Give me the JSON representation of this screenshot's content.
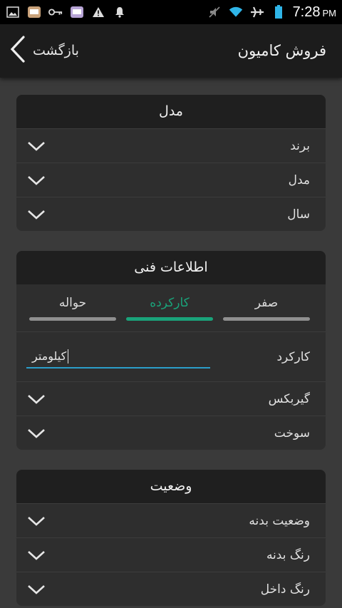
{
  "status_bar": {
    "time": "7:28",
    "ampm": "PM",
    "left_icons": [
      "image-icon",
      "app-icon",
      "key-icon",
      "app2-icon",
      "warning-icon",
      "bell-icon"
    ],
    "right_icons": [
      "mute-icon",
      "wifi-icon",
      "airplane-icon",
      "battery-icon"
    ]
  },
  "header": {
    "title": "فروش کامیون",
    "back_label": "بازگشت"
  },
  "model_card": {
    "title": "مدل",
    "rows": [
      {
        "label": "برند"
      },
      {
        "label": "مدل"
      },
      {
        "label": "سال"
      }
    ]
  },
  "tech_card": {
    "title": "اطلاعات فنی",
    "segments": [
      {
        "label": "صفر",
        "active": false
      },
      {
        "label": "کارکرده",
        "active": true
      },
      {
        "label": "حواله",
        "active": false
      }
    ],
    "mileage": {
      "label": "کارکرد",
      "value": "کیلومتر"
    },
    "rows": [
      {
        "label": "گیربکس"
      },
      {
        "label": "سوخت"
      }
    ]
  },
  "condition_card": {
    "title": "وضعیت",
    "rows": [
      {
        "label": "وضعیت بدنه"
      },
      {
        "label": "رنگ بدنه"
      },
      {
        "label": "رنگ داخل"
      }
    ]
  },
  "colors": {
    "accent": "#1aa37a",
    "input_underline": "#2b9ec9",
    "background": "#3a3a3a",
    "card": "#2e2e2e"
  }
}
